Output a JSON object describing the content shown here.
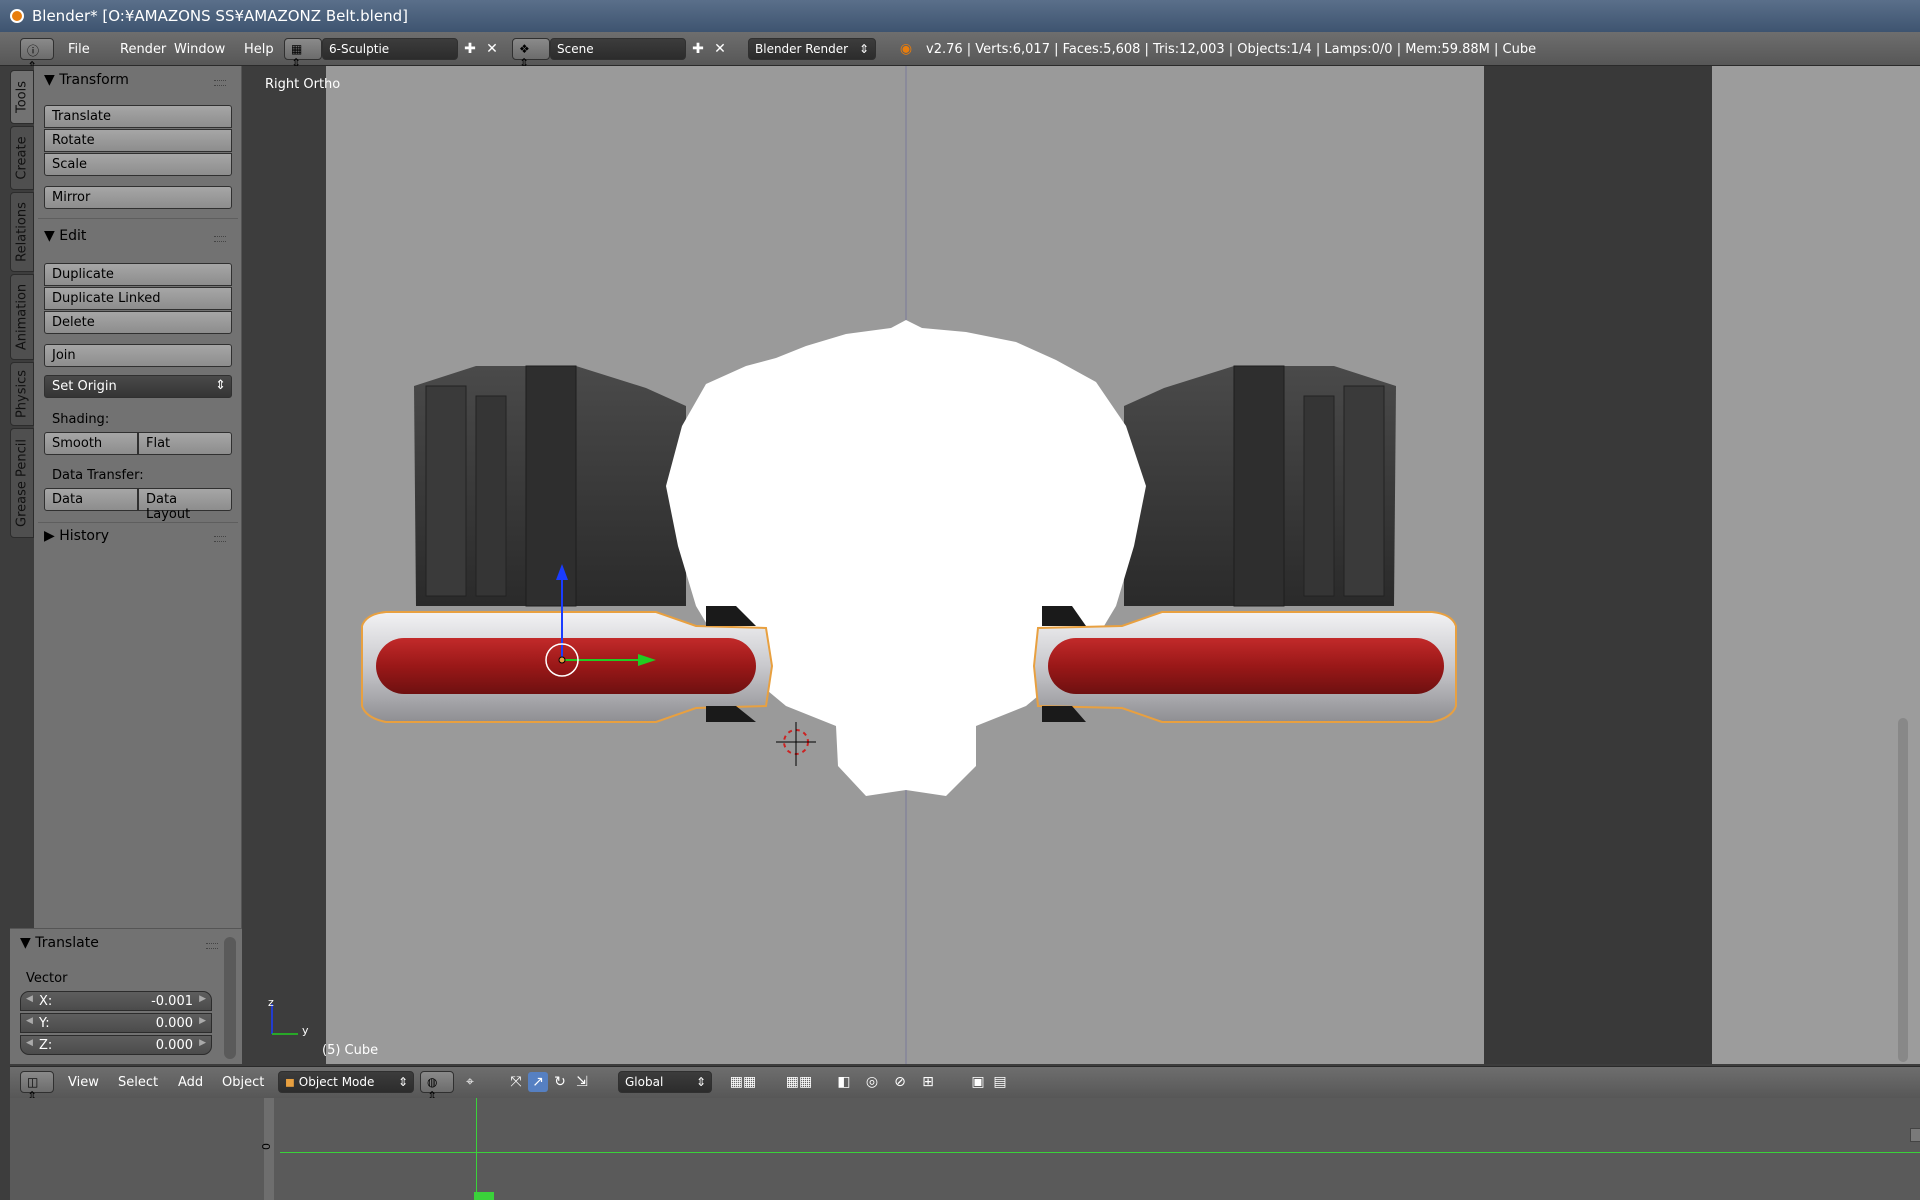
{
  "window": {
    "title": "Blender* [O:¥AMAZONS SS¥AMAZONZ Belt.blend]"
  },
  "info_header": {
    "menus": [
      "File",
      "Render",
      "Window",
      "Help"
    ],
    "screen_layout": "6-Sculptie",
    "scene": "Scene",
    "render_engine": "Blender Render",
    "stats": "v2.76 | Verts:6,017 | Faces:5,608 | Tris:12,003 | Objects:1/4 | Lamps:0/0 | Mem:59.88M | Cube"
  },
  "tool_tabs": [
    "Tools",
    "Create",
    "Relations",
    "Animation",
    "Physics",
    "Grease Pencil"
  ],
  "tool_shelf": {
    "transform": {
      "title": "Transform",
      "buttons": [
        "Translate",
        "Rotate",
        "Scale",
        "Mirror"
      ]
    },
    "edit": {
      "title": "Edit",
      "buttons": [
        "Duplicate",
        "Duplicate Linked",
        "Delete",
        "Join"
      ],
      "set_origin": "Set Origin",
      "shading_label": "Shading:",
      "shading_buttons": [
        "Smooth",
        "Flat"
      ],
      "data_transfer_label": "Data Transfer:",
      "data_transfer_buttons": [
        "Data",
        "Data Layout"
      ]
    },
    "history": {
      "title": "History"
    }
  },
  "redo_panel": {
    "title": "Translate",
    "vector_label": "Vector",
    "fields": [
      {
        "key": "X:",
        "value": "-0.001"
      },
      {
        "key": "Y:",
        "value": "0.000"
      },
      {
        "key": "Z:",
        "value": "0.000"
      }
    ]
  },
  "viewport": {
    "view_name": "Right Ortho",
    "object_info": "(5) Cube",
    "axis_z": "z",
    "axis_y": "y"
  },
  "view3d_header": {
    "menus": [
      "View",
      "Select",
      "Add",
      "Object"
    ],
    "mode": "Object Mode",
    "orientation": "Global"
  },
  "timeline": {
    "frame_marker": "0"
  },
  "colors": {
    "accent_orange": "#e8a040",
    "belt_red": "#a01c1c",
    "gizmo_blue": "#1a3cff",
    "gizmo_green": "#22cc22",
    "timeline_green": "#3ad23a"
  }
}
